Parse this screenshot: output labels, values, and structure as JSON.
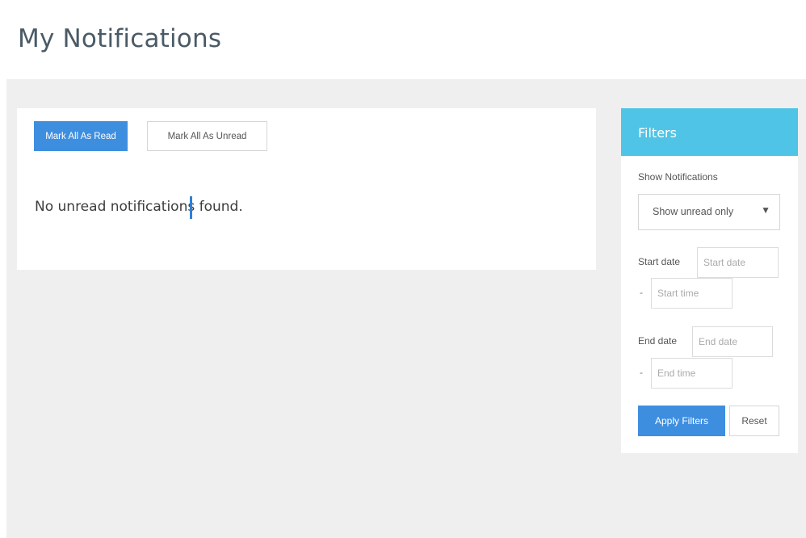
{
  "page": {
    "title": "My Notifications"
  },
  "toolbar": {
    "mark_all_read_label": "Mark All As Read",
    "mark_all_unread_label": "Mark All As Unread"
  },
  "main": {
    "empty_message": "No unread notifications found."
  },
  "filters": {
    "title": "Filters",
    "show_notifications_label": "Show Notifications",
    "show_notifications_selected": "Show unread only",
    "caret_icon": "▼",
    "start_date_label": "Start date",
    "start_date_placeholder": "Start date",
    "start_time_placeholder": "Start time",
    "end_date_label": "End date",
    "end_date_placeholder": "End date",
    "end_time_placeholder": "End time",
    "separator": "-",
    "apply_label": "Apply Filters",
    "reset_label": "Reset"
  },
  "colors": {
    "primary_button": "#3e8ee0",
    "filters_header": "#4fc4e6",
    "content_background": "#efefef"
  }
}
